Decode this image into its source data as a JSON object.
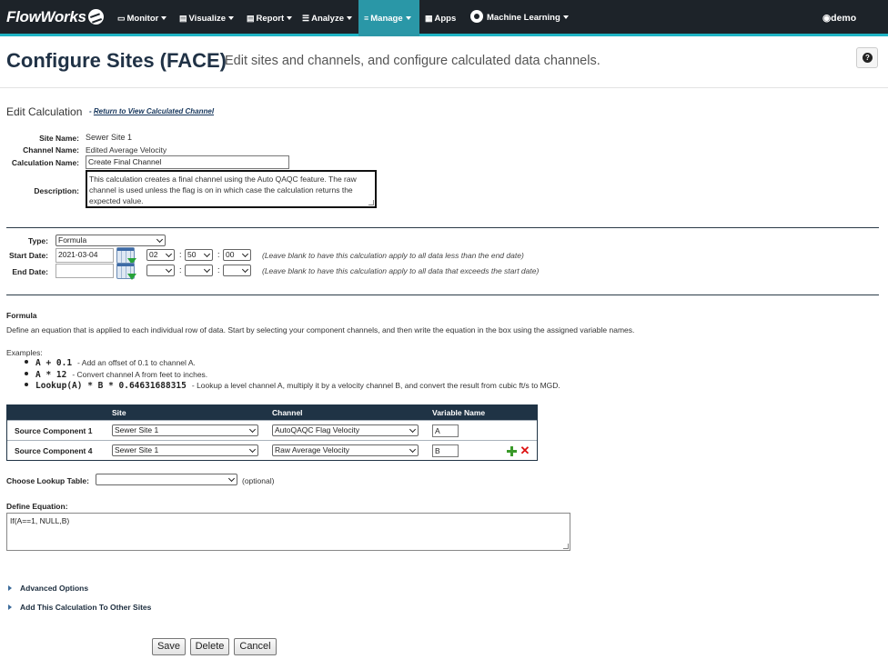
{
  "nav": {
    "logo": "FlowWorks",
    "items": [
      {
        "label": "Monitor",
        "icon": "monitor-icon"
      },
      {
        "label": "Visualize",
        "icon": "bar-chart-icon"
      },
      {
        "label": "Report",
        "icon": "report-icon"
      },
      {
        "label": "Analyze",
        "icon": "list-icon"
      },
      {
        "label": "Manage",
        "icon": "sliders-icon",
        "active": true
      },
      {
        "label": "Apps",
        "icon": "grid-icon"
      },
      {
        "label": "Machine Learning",
        "icon": "ml-icon"
      }
    ],
    "user": "demo",
    "accent_color": "#1fb3c4",
    "bar_color": "#1d2329"
  },
  "header": {
    "title": "Configure Sites (FACE)",
    "subtitle": "Edit sites and channels, and configure calculated data channels."
  },
  "edit": {
    "heading": "Edit Calculation",
    "return_prefix": "- ",
    "return_link": "Return to View Calculated Channel",
    "site_name_label": "Site Name:",
    "site_name": "Sewer Site 1",
    "channel_name_label": "Channel Name:",
    "channel_name": "Edited Average Velocity",
    "calc_name_label": "Calculation Name:",
    "calc_name": "Create Final Channel",
    "description_label": "Description:",
    "description": "This calculation creates a final channel using the Auto QAQC feature.  The raw channel is used unless the flag is on in which case the calculation returns the expected value."
  },
  "schedule": {
    "type_label": "Type:",
    "type_value": "Formula",
    "start_label": "Start Date:",
    "start_date": "2021-03-04",
    "start_hour": "02",
    "start_min": "50",
    "start_sec": "00",
    "start_hint": "(Leave blank to have this calculation apply to all data less than the end date)",
    "end_label": "End Date:",
    "end_date": "",
    "end_hint": "(Leave blank to have this calculation apply to all data that exceeds the start date)",
    "colon": ":"
  },
  "formula": {
    "heading": "Formula",
    "intro": "Define an equation that is applied to each individual row of data. Start by selecting your component channels, and then write the equation in the box using the assigned variable names.",
    "examples_label": "Examples:",
    "examples": [
      {
        "code": "A + 0.1",
        "desc": "- Add an offset of 0.1 to channel A."
      },
      {
        "code": "A * 12",
        "desc": "- Convert channel A from feet to inches."
      },
      {
        "code": "Lookup(A) * B * 0.64631688315",
        "desc": "- Lookup a level channel A, multiply it by a velocity channel B, and convert the result from cubic ft/s to MGD."
      }
    ]
  },
  "components": {
    "headers": {
      "site": "Site",
      "channel": "Channel",
      "variable": "Variable Name"
    },
    "rows": [
      {
        "label": "Source Component 1",
        "site": "Sewer Site 1",
        "channel": "AutoQAQC Flag Velocity",
        "variable": "A"
      },
      {
        "label": "Source Component 4",
        "site": "Sewer Site 1",
        "channel": "Raw Average Velocity",
        "variable": "B"
      }
    ],
    "header_color": "#1f3345"
  },
  "lookup": {
    "label": "Choose Lookup Table:",
    "value": "",
    "optional": "(optional)"
  },
  "equation": {
    "label": "Define Equation:",
    "value": "If(A==1, NULL,B)"
  },
  "sections": {
    "advanced": "Advanced Options",
    "add_other": "Add This Calculation To Other Sites"
  },
  "buttons": {
    "save": "Save",
    "delete": "Delete",
    "cancel": "Cancel"
  }
}
